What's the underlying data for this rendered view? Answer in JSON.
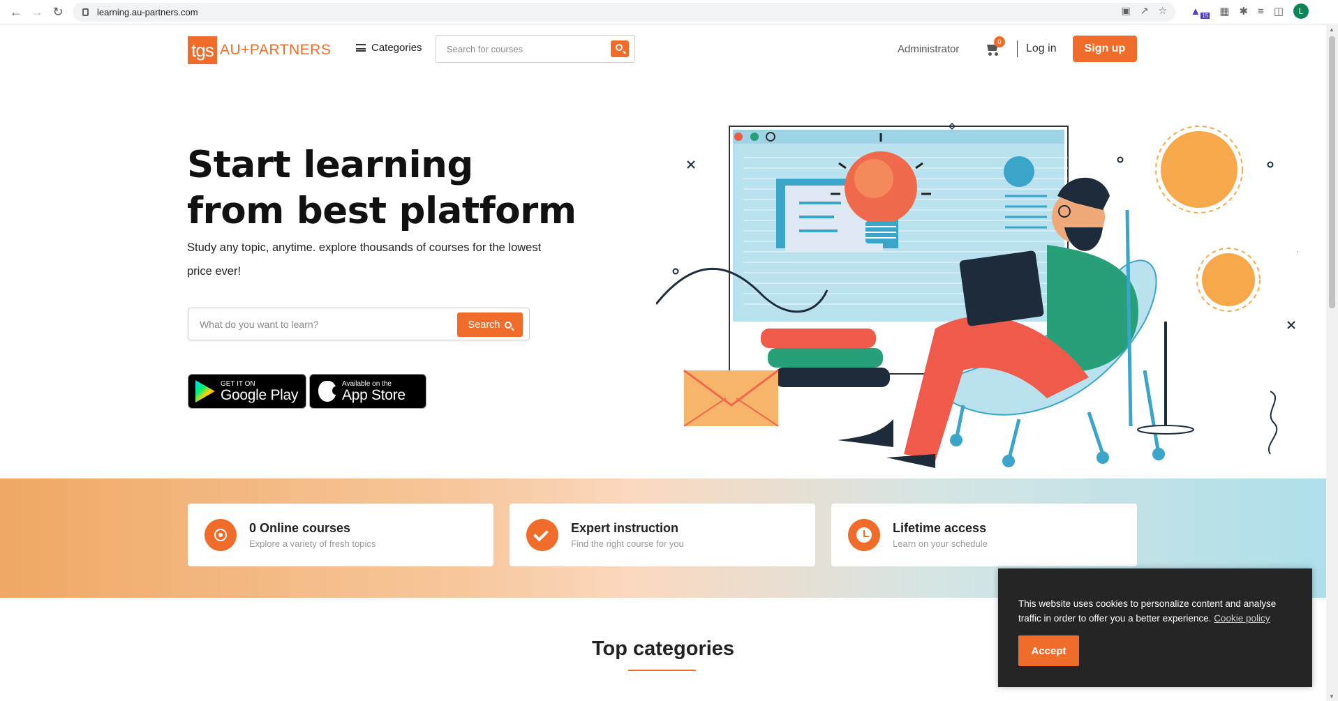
{
  "browser": {
    "url": "learning.au-partners.com",
    "profile_initial": "L",
    "extension_badge": "15"
  },
  "header": {
    "logo_box": "tgs",
    "logo_text": "AU+PARTNERS",
    "categories_label": "Categories",
    "search_placeholder": "Search for courses",
    "admin_label": "Administrator",
    "cart_count": "0",
    "login_label": "Log in",
    "signup_label": "Sign up"
  },
  "hero": {
    "title": "Start learning from best platform",
    "subtitle": "Study any topic, anytime. explore thousands of courses for the lowest price ever!",
    "search_placeholder": "What do you want to learn?",
    "search_button": "Search",
    "google_play_small": "GET IT ON",
    "google_play_large": "Google Play",
    "app_store_small": "Available on the",
    "app_store_large": "App Store"
  },
  "features": [
    {
      "title": "0 Online courses",
      "subtitle": "Explore a variety of fresh topics",
      "icon": "target-icon"
    },
    {
      "title": "Expert instruction",
      "subtitle": "Find the right course for you",
      "icon": "check-icon"
    },
    {
      "title": "Lifetime access",
      "subtitle": "Learn on your schedule",
      "icon": "clock-icon"
    }
  ],
  "section": {
    "top_categories": "Top categories"
  },
  "cookie": {
    "message": "This website uses cookies to personalize content and analyse traffic in order to offer you a better experience.",
    "policy_link": "Cookie policy",
    "accept_label": "Accept"
  },
  "colors": {
    "accent": "#ef6c2b",
    "cookie_bg": "#252525"
  }
}
